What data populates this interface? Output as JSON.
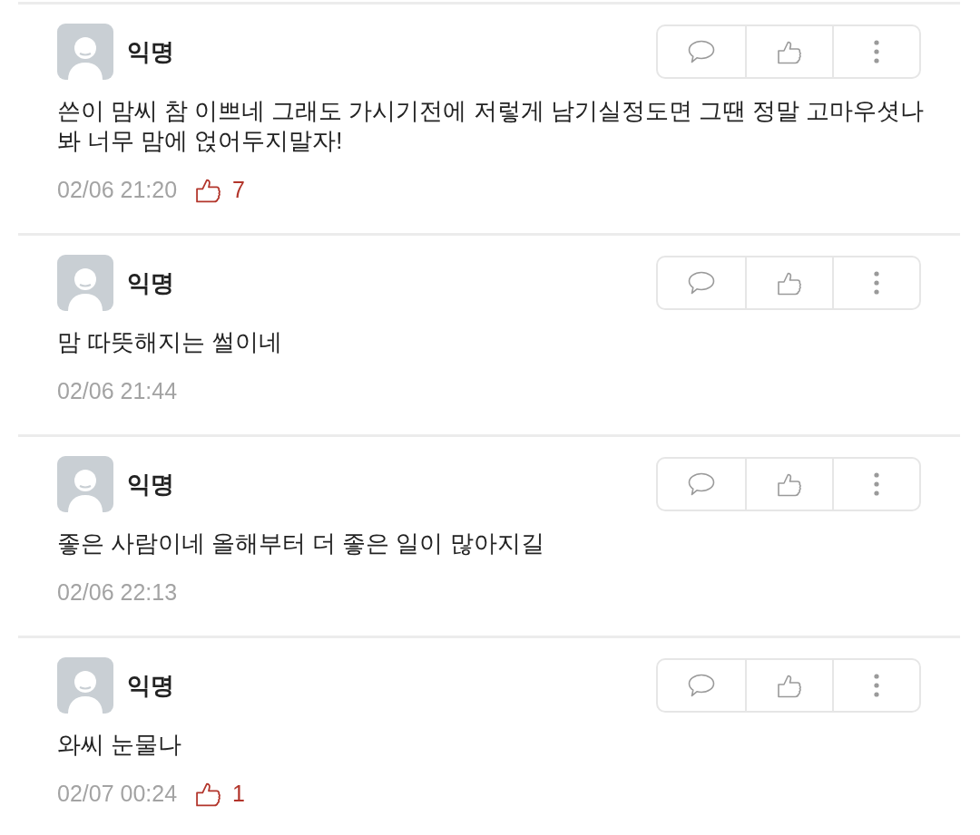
{
  "comments": [
    {
      "author": "익명",
      "text": "쓴이 맘씨 참 이쁘네 그래도 가시기전에 저렇게 남기실정도면 그땐 정말 고마우셧나 봐 너무 맘에 얹어두지말자!",
      "time": "02/06 21:20",
      "likes": "7"
    },
    {
      "author": "익명",
      "text": "맘 따뜻해지는 썰이네",
      "time": "02/06 21:44"
    },
    {
      "author": "익명",
      "text": "좋은 사람이네 올해부터 더 좋은 일이 많아지길",
      "time": "02/06 22:13"
    },
    {
      "author": "익명",
      "text": "와씨 눈물나",
      "time": "02/07 00:24",
      "likes": "1"
    }
  ]
}
